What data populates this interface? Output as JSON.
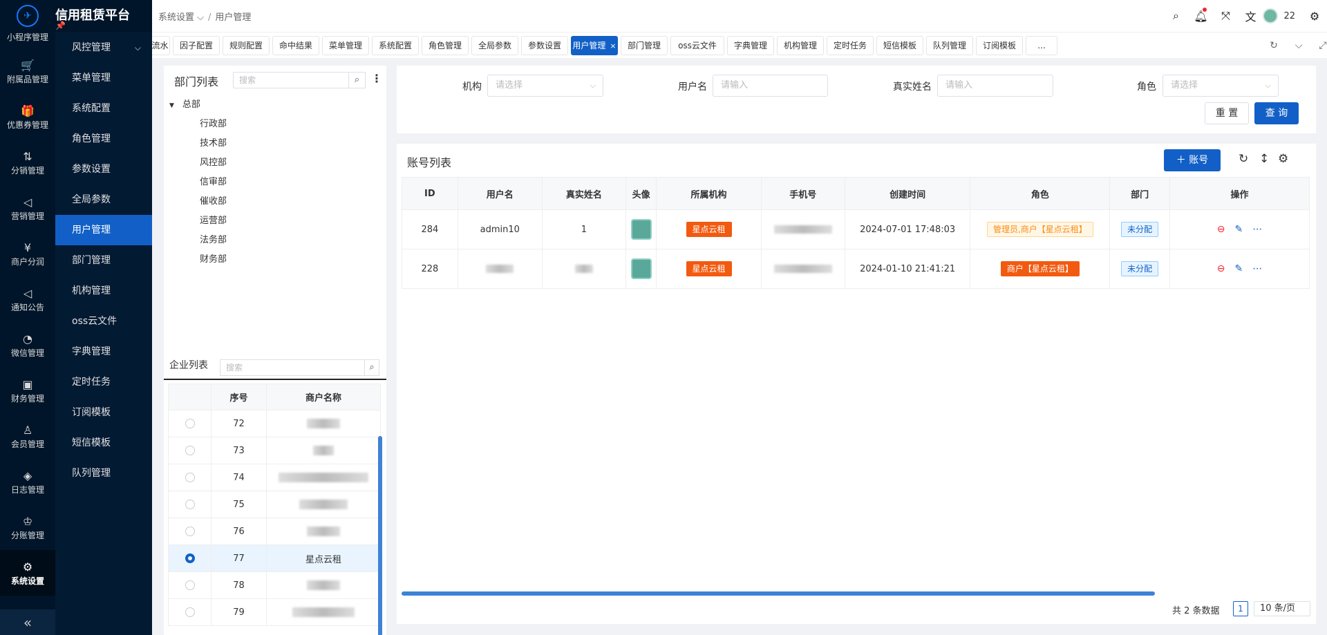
{
  "app": {
    "title": "信用租赁平台"
  },
  "rail": {
    "partial_label": "小程序管理",
    "items": [
      {
        "icon": "cart-icon",
        "glyph": "🛒",
        "label": "附属品管理"
      },
      {
        "icon": "gift-icon",
        "glyph": "🎁",
        "label": "优惠券管理"
      },
      {
        "icon": "split-icon",
        "glyph": "⇅",
        "label": "分销管理"
      },
      {
        "icon": "megaphone-icon",
        "glyph": "◁",
        "label": "营销管理"
      },
      {
        "icon": "yen-icon",
        "glyph": "¥",
        "label": "商户分润"
      },
      {
        "icon": "notice-icon",
        "glyph": "◁",
        "label": "通知公告"
      },
      {
        "icon": "wechat-icon",
        "glyph": "◔",
        "label": "微信管理"
      },
      {
        "icon": "finance-icon",
        "glyph": "▣",
        "label": "财务管理"
      },
      {
        "icon": "member-icon",
        "glyph": "♙",
        "label": "会员管理"
      },
      {
        "icon": "log-icon",
        "glyph": "◈",
        "label": "日志管理"
      },
      {
        "icon": "split-account-icon",
        "glyph": "♔",
        "label": "分账管理"
      },
      {
        "icon": "gear-icon",
        "glyph": "⚙",
        "label": "系统设置"
      }
    ],
    "collapse": "«"
  },
  "submenu": {
    "items": [
      "风控管理",
      "菜单管理",
      "系统配置",
      "角色管理",
      "参数设置",
      "全局参数",
      "用户管理",
      "部门管理",
      "机构管理",
      "oss云文件",
      "字典管理",
      "定时任务",
      "订阅模板",
      "短信模板",
      "队列管理"
    ],
    "active_index": 6
  },
  "header": {
    "breadcrumb": [
      "系统设置",
      "用户管理"
    ],
    "user_name": "22"
  },
  "tabs": {
    "items": [
      "流水",
      "因子配置",
      "规则配置",
      "命中结果",
      "菜单管理",
      "系统配置",
      "角色管理",
      "全局参数",
      "参数设置",
      "用户管理",
      "部门管理",
      "oss云文件",
      "字典管理",
      "机构管理",
      "定时任务",
      "短信模板",
      "队列管理",
      "订阅模板",
      "..."
    ],
    "active_index": 9
  },
  "dept": {
    "title": "部门列表",
    "search_placeholder": "搜索",
    "root": "总部",
    "children": [
      "行政部",
      "技术部",
      "风控部",
      "信审部",
      "催收部",
      "运营部",
      "法务部",
      "财务部"
    ]
  },
  "company": {
    "title": "企业列表",
    "search_placeholder": "搜索",
    "columns": [
      "序号",
      "商户名称"
    ],
    "rows": [
      {
        "no": "72",
        "name": ""
      },
      {
        "no": "73",
        "name": ""
      },
      {
        "no": "74",
        "name": ""
      },
      {
        "no": "75",
        "name": ""
      },
      {
        "no": "76",
        "name": ""
      },
      {
        "no": "77",
        "name": "星点云租"
      },
      {
        "no": "78",
        "name": ""
      },
      {
        "no": "79",
        "name": ""
      }
    ],
    "selected_no": "77"
  },
  "filter": {
    "org_label": "机构",
    "org_placeholder": "请选择",
    "username_label": "用户名",
    "username_placeholder": "请输入",
    "realname_label": "真实姓名",
    "realname_placeholder": "请输入",
    "role_label": "角色",
    "role_placeholder": "请选择",
    "reset": "重 置",
    "query": "查 询"
  },
  "accounts": {
    "title": "账号列表",
    "add_label": "＋ 账号",
    "columns": [
      "ID",
      "用户名",
      "真实姓名",
      "头像",
      "所属机构",
      "手机号",
      "创建时间",
      "角色",
      "部门",
      "操作"
    ],
    "rows": [
      {
        "id": "284",
        "username": "admin10",
        "realname": "1",
        "org": "星点云租",
        "phone": "",
        "created": "2024-07-01 17:48:03",
        "role": "管理员,商户【星点云租】",
        "dept": "未分配"
      },
      {
        "id": "228",
        "username": "",
        "realname": "",
        "org": "星点云租",
        "phone": "",
        "created": "2024-01-10 21:41:21",
        "role": "商户【星点云租】",
        "dept": "未分配"
      }
    ],
    "total_text": "共 2 条数据",
    "page": "1",
    "page_size": "10 条/页"
  },
  "colors": {
    "primary": "#1260c7",
    "sidebar": "#001529",
    "tag_red": "#f25a10"
  }
}
